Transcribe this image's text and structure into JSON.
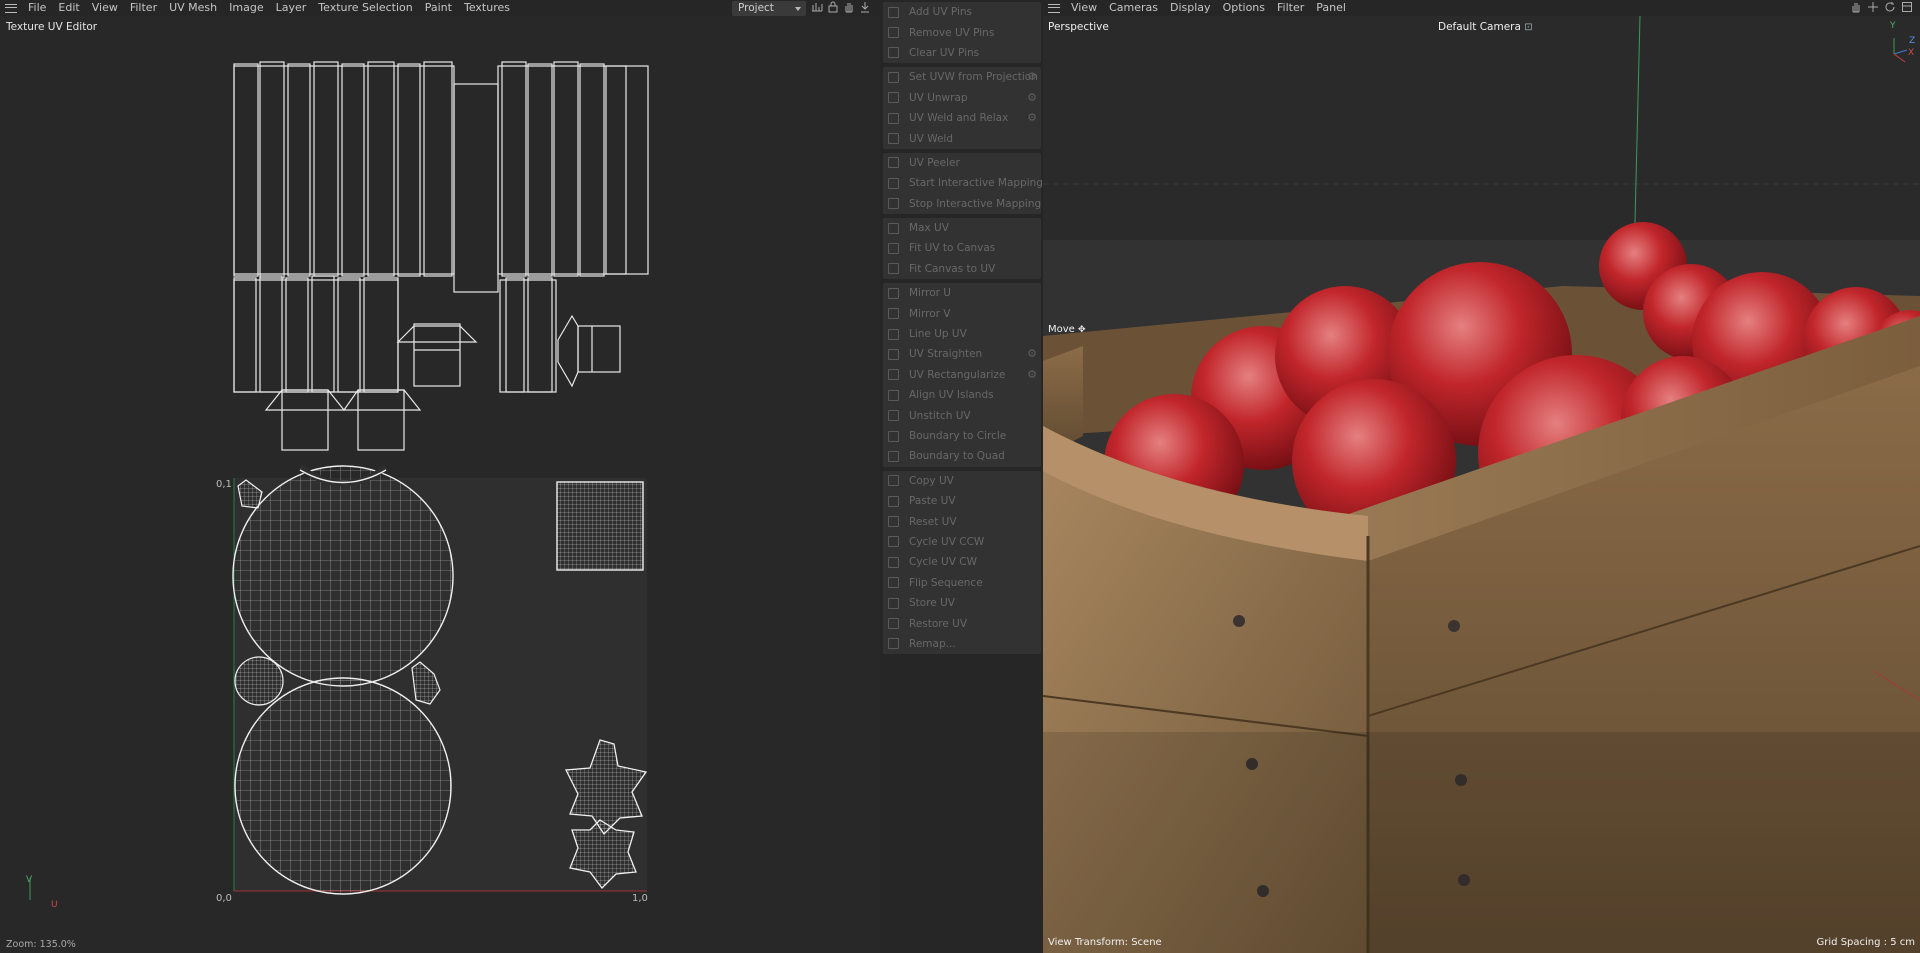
{
  "uv_editor": {
    "menu": [
      "File",
      "Edit",
      "View",
      "Filter",
      "UV Mesh",
      "Image",
      "Layer",
      "Texture Selection",
      "Paint",
      "Textures"
    ],
    "project_select": "Project",
    "panel_title": "Texture UV Editor",
    "axis": {
      "origin": "0,0",
      "v_max": "0,1",
      "u_max": "1,0",
      "u": "U",
      "v": "V"
    },
    "zoom": "Zoom: 135.0%",
    "icons": [
      "bar-chart-icon",
      "lock-icon",
      "hand-icon",
      "download-icon"
    ]
  },
  "uv_commands": {
    "groups": [
      [
        {
          "label": "Add UV Pins",
          "icon": "pin-icon"
        },
        {
          "label": "Remove UV Pins",
          "icon": "pin-remove-icon"
        },
        {
          "label": "Clear UV Pins",
          "icon": "clear-icon"
        }
      ],
      [
        {
          "label": "Set UVW from Projection",
          "icon": "projection-icon",
          "gear": true
        },
        {
          "label": "UV Unwrap",
          "icon": "unwrap-icon",
          "gear": true
        },
        {
          "label": "UV Weld and Relax",
          "icon": "weld-relax-icon",
          "gear": true
        },
        {
          "label": "UV Weld",
          "icon": "weld-icon"
        }
      ],
      [
        {
          "label": "UV Peeler",
          "icon": "peeler-icon"
        },
        {
          "label": "Start Interactive Mapping",
          "icon": "play-icon"
        },
        {
          "label": "Stop Interactive Mapping",
          "icon": "stop-icon"
        }
      ],
      [
        {
          "label": "Max UV",
          "icon": "max-icon"
        },
        {
          "label": "Fit UV to Canvas",
          "icon": "fit-icon"
        },
        {
          "label": "Fit Canvas to UV",
          "icon": "fit-canvas-icon"
        }
      ],
      [
        {
          "label": "Mirror U",
          "icon": "mirror-u-icon"
        },
        {
          "label": "Mirror V",
          "icon": "mirror-v-icon"
        },
        {
          "label": "Line Up UV",
          "icon": "line-up-icon"
        },
        {
          "label": "UV Straighten",
          "icon": "straighten-icon",
          "gear": true
        },
        {
          "label": "UV Rectangularize",
          "icon": "rectangularize-icon",
          "gear": true
        },
        {
          "label": "Align UV Islands",
          "icon": "align-icon"
        },
        {
          "label": "Unstitch UV",
          "icon": "unstitch-icon"
        },
        {
          "label": "Boundary to Circle",
          "icon": "circle-icon"
        },
        {
          "label": "Boundary to Quad",
          "icon": "quad-icon"
        }
      ],
      [
        {
          "label": "Copy UV",
          "icon": "copy-icon"
        },
        {
          "label": "Paste UV",
          "icon": "paste-icon"
        },
        {
          "label": "Reset UV",
          "icon": "reset-icon"
        },
        {
          "label": "Cycle UV CCW",
          "icon": "ccw-icon"
        },
        {
          "label": "Cycle UV CW",
          "icon": "cw-icon"
        },
        {
          "label": "Flip Sequence",
          "icon": "flip-icon"
        },
        {
          "label": "Store UV",
          "icon": "store-icon"
        },
        {
          "label": "Restore UV",
          "icon": "restore-icon"
        },
        {
          "label": "Remap...",
          "icon": "remap-icon"
        }
      ]
    ]
  },
  "viewport": {
    "menu": [
      "View",
      "Cameras",
      "Display",
      "Options",
      "Filter",
      "Panel"
    ],
    "view_name": "Perspective",
    "camera": "Default Camera",
    "tool": "Move",
    "view_transform": "View Transform: Scene",
    "grid_spacing": "Grid Spacing : 5 cm",
    "axis": {
      "y": "Y",
      "z": "Z",
      "x": "X"
    },
    "icons": [
      "hand-icon",
      "move-icon",
      "rotate-icon",
      "maximize-icon"
    ]
  }
}
